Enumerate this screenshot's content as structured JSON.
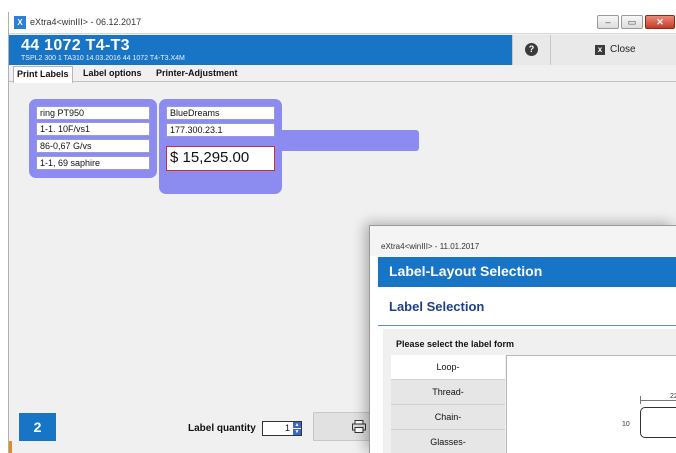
{
  "window": {
    "title": "eXtra4<winIII> - 06.12.2017",
    "app_icon": "X",
    "minimize_icon": "‒",
    "maximize_icon": "▭",
    "close_icon": "✕"
  },
  "record": {
    "title": "44 1072 T4-T3",
    "subtitle": "TSPL2    300 1    TA310   14.03.2016   44 1072 T4-T3.X4M"
  },
  "toolbar": {
    "help_glyph": "?",
    "close_glyph": "x",
    "close_label": "Close"
  },
  "tabs": [
    {
      "label": "Print Labels",
      "active": true
    },
    {
      "label": "Label options",
      "active": false
    },
    {
      "label": "Printer-Adjustment",
      "active": false
    }
  ],
  "label_preview": {
    "left_lines": [
      "ring PT950",
      "1-1. 10F/vs1",
      "86-0,67 G/vs",
      "1-1, 69 saphire"
    ],
    "right_lines": [
      "BlueDreams",
      "177.300.23.1"
    ],
    "price": "$ 15,295.00",
    "panel_color": "#8c8cf0"
  },
  "footer": {
    "count_badge": "2",
    "quantity_label": "Label quantity",
    "quantity_value": "1",
    "print_icon": "printer-icon"
  },
  "dialog": {
    "title": "eXtra4<winIII>  -  11.01.2017",
    "header": "Label-Layout Selection",
    "subheader": "Label Selection",
    "prompt": "Please select the label form",
    "forms": [
      "Loop-",
      "Thread-",
      "Chain-",
      "Glasses-"
    ],
    "active_form_index": 0,
    "dim_width": "22",
    "dim_height": "10"
  },
  "colors": {
    "accent_blue": "#1874c4",
    "label_panel": "#8c8cf0",
    "price_border": "#d03030"
  }
}
